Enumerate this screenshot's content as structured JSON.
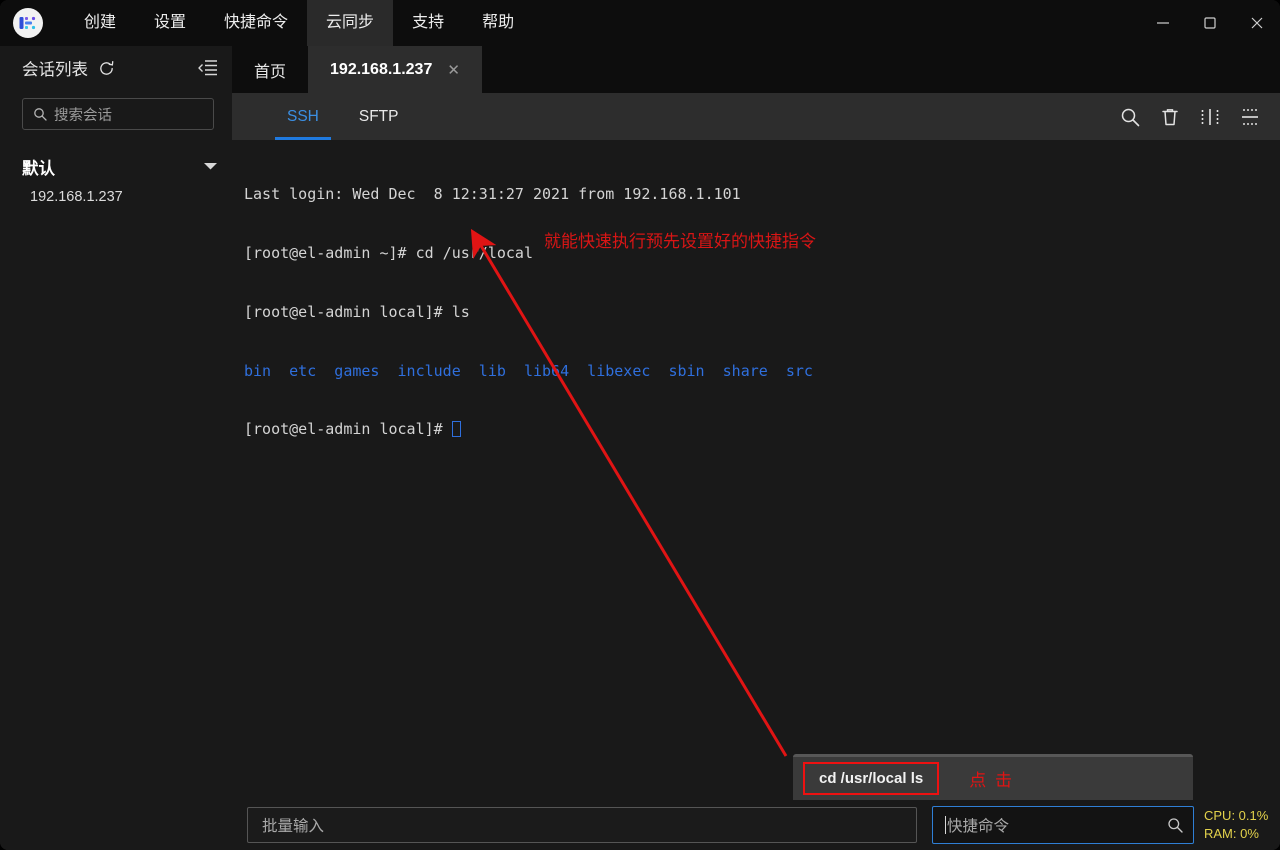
{
  "window": {
    "logo_icon": "app-logo-icon",
    "menu": [
      {
        "label": "创建",
        "name": "menu-create"
      },
      {
        "label": "设置",
        "name": "menu-settings"
      },
      {
        "label": "快捷命令",
        "name": "menu-quick-commands"
      },
      {
        "label": "云同步",
        "name": "menu-cloud-sync"
      },
      {
        "label": "支持",
        "name": "menu-support"
      },
      {
        "label": "帮助",
        "name": "menu-help"
      }
    ],
    "controls": {
      "minimize": "minimize-icon",
      "maximize": "maximize-icon",
      "close": "close-icon"
    }
  },
  "sidebar": {
    "title": "会话列表",
    "refresh_icon": "refresh-icon",
    "collapse_icon": "collapse-panel-icon",
    "search": {
      "placeholder": "搜索会话",
      "value": "",
      "icon": "search-icon"
    },
    "group": {
      "label": "默认",
      "arrow_icon": "chevron-down-icon"
    },
    "items": [
      {
        "label": "192.168.1.237"
      }
    ]
  },
  "tabs": [
    {
      "label": "首页",
      "active": false,
      "closable": false
    },
    {
      "label": "192.168.1.237",
      "active": true,
      "closable": true,
      "close_label": "✕"
    }
  ],
  "subtabs": [
    {
      "label": "SSH",
      "active": true
    },
    {
      "label": "SFTP",
      "active": false
    }
  ],
  "subtools": [
    {
      "name": "search-icon"
    },
    {
      "name": "trash-icon"
    },
    {
      "name": "split-vertical-icon"
    },
    {
      "name": "split-horizontal-icon"
    }
  ],
  "terminal": {
    "lines": [
      {
        "text": "Last login: Wed Dec  8 12:31:27 2021 from 192.168.1.101"
      },
      {
        "text": "[root@el-admin ~]# cd /usr/local"
      },
      {
        "text": "[root@el-admin local]# ls"
      },
      {
        "text": "bin  etc  games  include  lib  lib64  libexec  sbin  share  src",
        "class": "c-dir"
      },
      {
        "text": "[root@el-admin local]# ",
        "cursor": true
      }
    ]
  },
  "quick_command_panel": {
    "item": "cd /usr/local ls",
    "note": "点 击"
  },
  "bottom": {
    "batch_input": {
      "placeholder": "批量输入",
      "value": ""
    },
    "quick_input": {
      "placeholder": "快捷命令",
      "value": "",
      "icon": "search-icon"
    },
    "stats": {
      "cpu": "CPU: 0.1%",
      "ram": "RAM: 0%"
    }
  },
  "annotations": {
    "main_note": "就能快速执行预先设置好的快捷指令",
    "arrow_color": "#e01414"
  },
  "colors": {
    "accent_blue": "#2f7fd6",
    "annotation_red": "#e01414",
    "status_yellow": "#e3d24b",
    "dir_blue": "#2f6fdd"
  }
}
